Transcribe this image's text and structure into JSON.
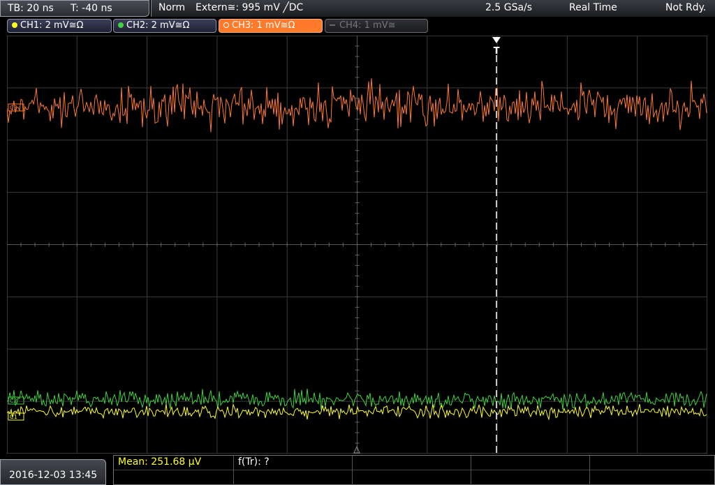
{
  "timebase": {
    "tb": "TB: 20 ns",
    "t": "T: -40 ns"
  },
  "status": {
    "mode": "Norm",
    "trigger": "Extern≅: 995 mV ╱DC",
    "sample_rate": "2.5 GSa/s",
    "acq": "Real Time",
    "state": "Not Rdy."
  },
  "channels": [
    {
      "label": "CH1: 2 mV≅Ω",
      "color": "#ffff20",
      "state": "on"
    },
    {
      "label": "CH2: 2 mV≅Ω",
      "color": "#40d040",
      "state": "on"
    },
    {
      "label": "CH3: 1 mV≅Ω",
      "color": "#ff7a2b",
      "state": "active"
    },
    {
      "label": "CH4: 1 mV≅",
      "color": "#777777",
      "state": "off"
    }
  ],
  "markers": {
    "c1": "C1",
    "c2": "C2",
    "c3": "C3",
    "trigger": "T"
  },
  "waveform_colors": {
    "ch1": "#ffff20",
    "ch2": "#40d040",
    "ch3": "#ff7a2b",
    "grid": "#3a3a3a"
  },
  "date": "2016-12-03 13:45",
  "measurements": {
    "mean": "Mean: 251.68 µV",
    "freq": "f(Tr): ?"
  }
}
